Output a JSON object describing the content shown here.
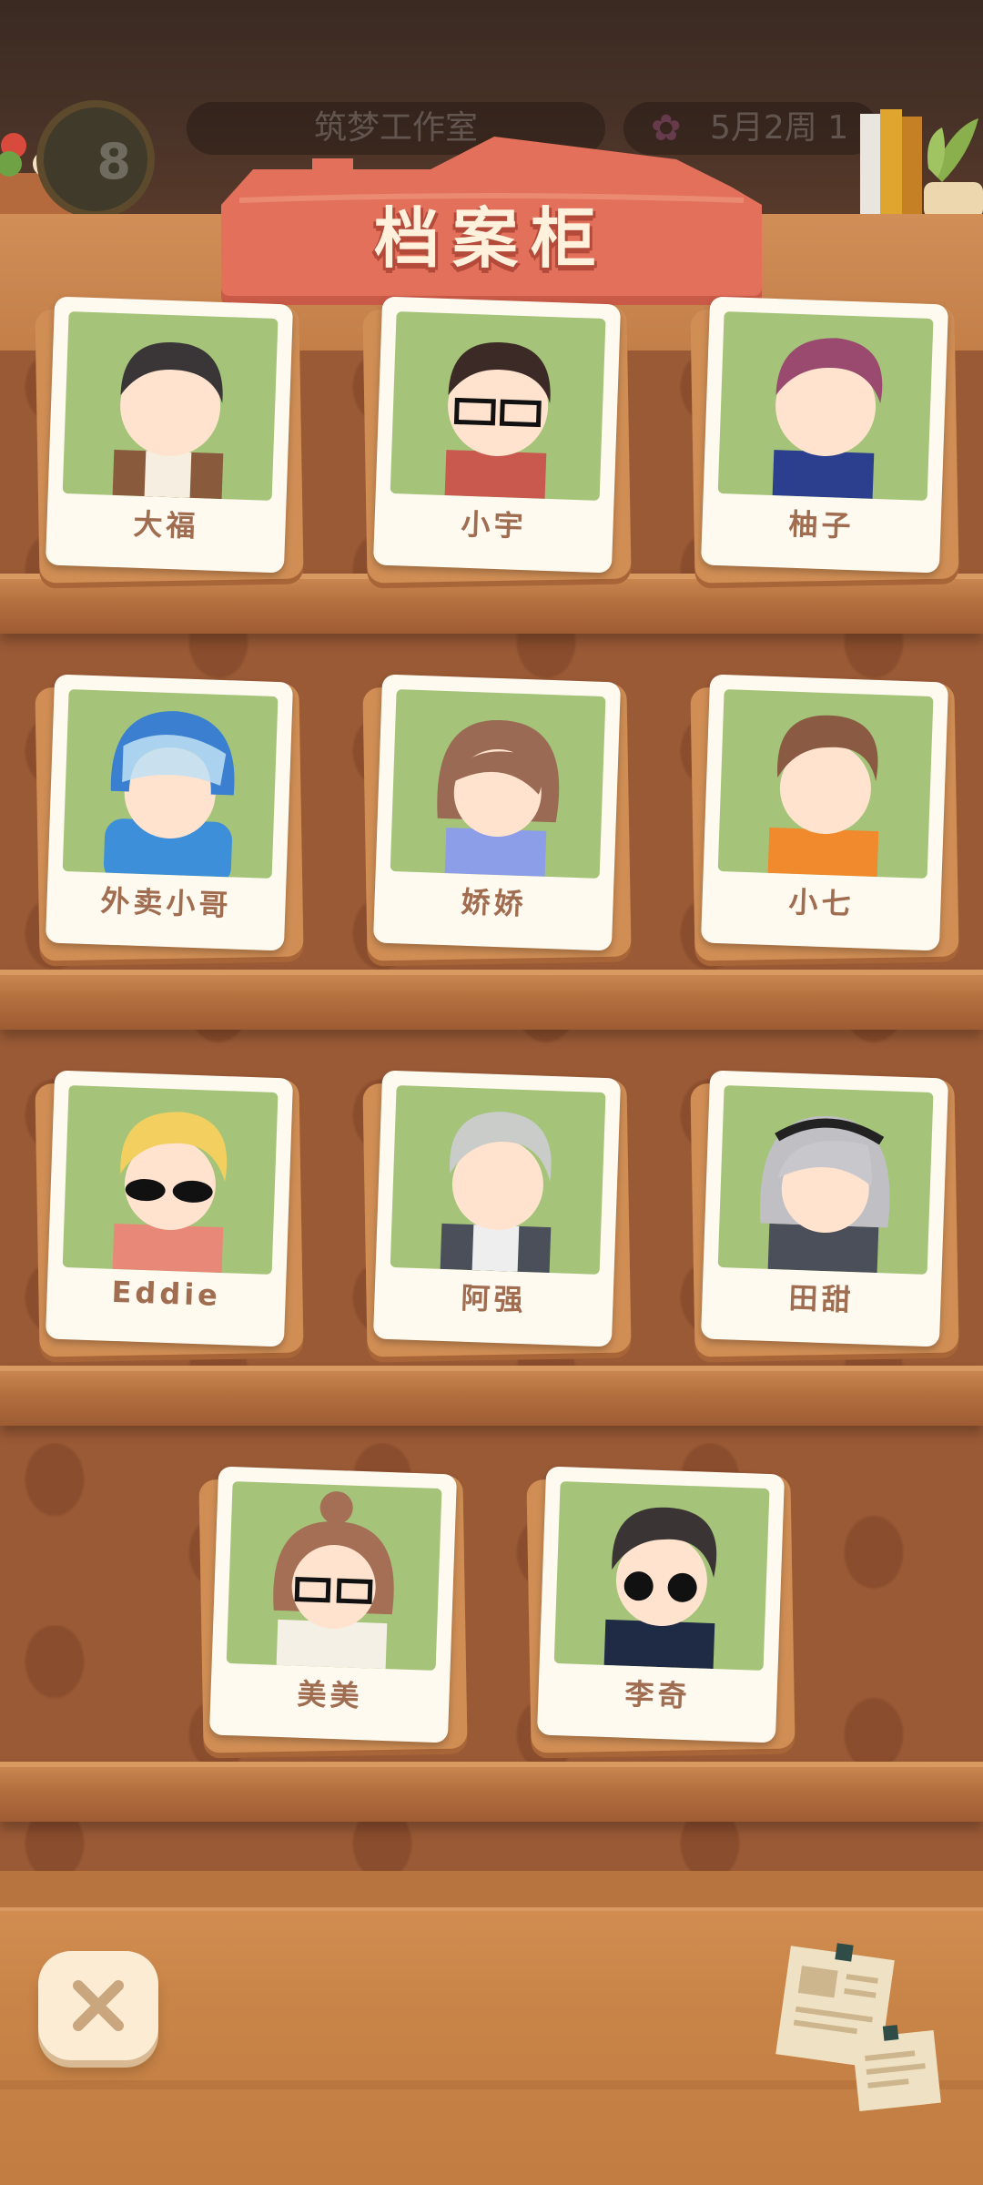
{
  "status": {
    "studio_name": "筑梦工作室",
    "date": "5月2周 1",
    "level": "8"
  },
  "header": {
    "title": "档案柜"
  },
  "characters": [
    {
      "name": "大福",
      "icon": "avatar-dafu-icon"
    },
    {
      "name": "小宇",
      "icon": "avatar-xiaoyu-icon"
    },
    {
      "name": "柚子",
      "icon": "avatar-youzi-icon"
    },
    {
      "name": "外卖小哥",
      "icon": "avatar-delivery-icon"
    },
    {
      "name": "娇娇",
      "icon": "avatar-jiaojiao-icon"
    },
    {
      "name": "小七",
      "icon": "avatar-xiaoqi-icon"
    },
    {
      "name": "Eddie",
      "icon": "avatar-eddie-icon"
    },
    {
      "name": "阿强",
      "icon": "avatar-aqiang-icon"
    },
    {
      "name": "田甜",
      "icon": "avatar-tiantian-icon"
    },
    {
      "name": "美美",
      "icon": "avatar-meimei-icon"
    },
    {
      "name": "李奇",
      "icon": "avatar-liqi-icon"
    }
  ],
  "colors": {
    "photo_bg": "#a5c47a",
    "card_frame": "#fffaf0",
    "title_banner": "#e2705b",
    "shelf": "#c47f49"
  },
  "controls": {
    "close_icon": "close-icon",
    "notes_icon": "notes-icon"
  }
}
